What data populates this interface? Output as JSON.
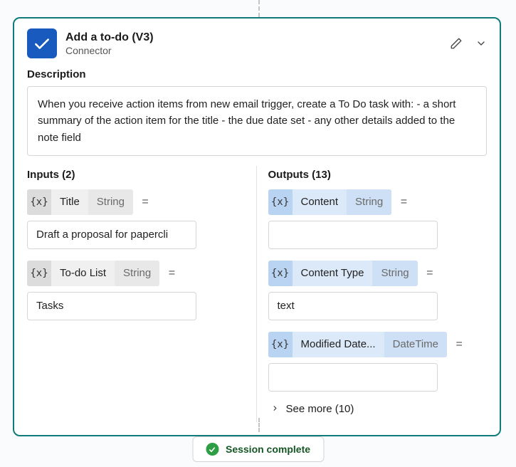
{
  "header": {
    "title": "Add a to-do (V3)",
    "subtitle": "Connector"
  },
  "description": {
    "label": "Description",
    "text": "When you receive action items from new email trigger, create a To Do task with: - a short summary of the action item for the title - the due date set - any other details added to the note field"
  },
  "inputs": {
    "heading": "Inputs (2)",
    "token": "{x}",
    "equals": "=",
    "items": [
      {
        "name": "Title",
        "type": "String",
        "value": "Draft a proposal for papercli"
      },
      {
        "name": "To-do List",
        "type": "String",
        "value": "Tasks"
      }
    ]
  },
  "outputs": {
    "heading": "Outputs (13)",
    "token": "{x}",
    "equals": "=",
    "items": [
      {
        "name": "Content",
        "type": "String",
        "value": ""
      },
      {
        "name": "Content Type",
        "type": "String",
        "value": "text"
      },
      {
        "name": "Modified Date...",
        "type": "DateTime",
        "value": ""
      }
    ],
    "see_more": "See more (10)"
  },
  "session": {
    "label": "Session complete"
  }
}
